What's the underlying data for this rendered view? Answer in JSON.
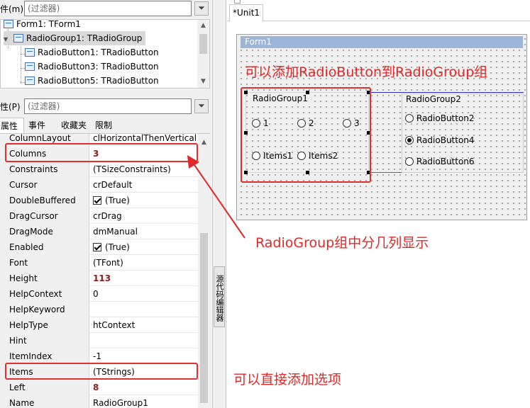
{
  "inspector": {
    "components_label": "件(m)",
    "filter_placeholder": "(过滤器)",
    "properties_label": "性(P)",
    "tree": [
      {
        "label": "Form1: TForm1"
      },
      {
        "label": "RadioGroup1: TRadioGroup"
      },
      {
        "label": "RadioButton1: TRadioButton"
      },
      {
        "label": "RadioButton3: TRadioButton"
      },
      {
        "label": "RadioButton5: TRadioButton"
      }
    ],
    "tabs": [
      "属性",
      "事件",
      "收藏夹",
      "限制"
    ],
    "properties": [
      {
        "name": "ColumnLayout",
        "value": "clHorizontalThenVertical"
      },
      {
        "name": "Columns",
        "value": "3"
      },
      {
        "name": "Constraints",
        "value": "(TSizeConstraints)"
      },
      {
        "name": "Cursor",
        "value": "crDefault"
      },
      {
        "name": "DoubleBuffered",
        "value": "(True)"
      },
      {
        "name": "DragCursor",
        "value": "crDrag"
      },
      {
        "name": "DragMode",
        "value": "dmManual"
      },
      {
        "name": "Enabled",
        "value": "(True)"
      },
      {
        "name": "Font",
        "value": "(TFont)"
      },
      {
        "name": "Height",
        "value": "113"
      },
      {
        "name": "HelpContext",
        "value": "0"
      },
      {
        "name": "HelpKeyword",
        "value": ""
      },
      {
        "name": "HelpType",
        "value": "htContext"
      },
      {
        "name": "Hint",
        "value": ""
      },
      {
        "name": "ItemIndex",
        "value": "-1"
      },
      {
        "name": "Items",
        "value": "(TStrings)"
      },
      {
        "name": "Left",
        "value": "8"
      },
      {
        "name": "Name",
        "value": "RadioGroup1"
      }
    ]
  },
  "splitter": {
    "side_tab_label": "源代码编辑器"
  },
  "designer": {
    "unit_tab": "*Unit1",
    "form_title": "Form1",
    "radiogroup1": {
      "caption": "RadioGroup1",
      "items": [
        "1",
        "2",
        "3",
        "Items1",
        "Items2"
      ]
    },
    "radiogroup2": {
      "caption": "RadioGroup2",
      "buttons": [
        "RadioButton2",
        "RadioButton4",
        "RadioButton6"
      ],
      "selected": "RadioButton4"
    }
  },
  "annotations": {
    "top": "可以添加RadioButton到RadioGroup组",
    "middle": "RadioGroup组中分几列显示",
    "bottom": "可以直接添加选项",
    "color": "#e02828"
  }
}
